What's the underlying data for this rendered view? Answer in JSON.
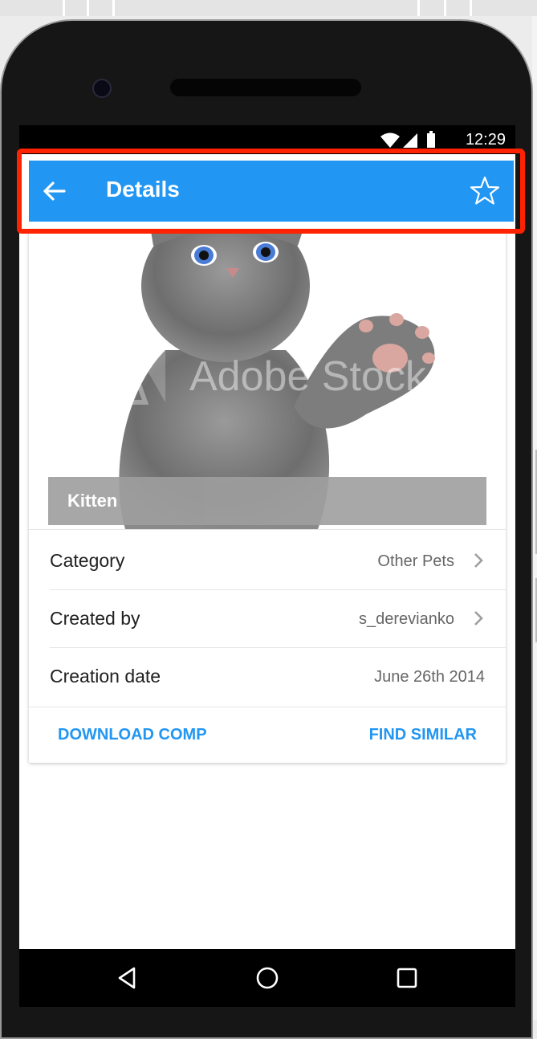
{
  "status_bar": {
    "time": "12:29"
  },
  "app_bar": {
    "title": "Details"
  },
  "image": {
    "caption": "Kitten",
    "watermark": "Adobe Stock"
  },
  "details": [
    {
      "label": "Category",
      "value": "Other Pets",
      "chevron": true
    },
    {
      "label": "Created by",
      "value": "s_derevianko",
      "chevron": true
    },
    {
      "label": "Creation date",
      "value": "June 26th 2014",
      "chevron": false
    }
  ],
  "actions": {
    "download": "DOWNLOAD COMP",
    "find_similar": "FIND SIMILAR"
  },
  "colors": {
    "primary": "#2196f3",
    "highlight": "#ff2200"
  },
  "icons": {
    "back": "arrow-back-icon",
    "favorite": "star-outline-icon",
    "nav_back": "triangle-back-icon",
    "nav_home": "circle-home-icon",
    "nav_recents": "square-recents-icon"
  }
}
